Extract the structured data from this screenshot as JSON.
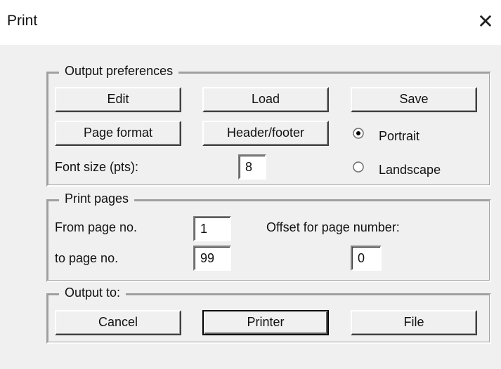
{
  "window": {
    "title": "Print"
  },
  "output_preferences": {
    "legend": "Output preferences",
    "edit_label": "Edit",
    "load_label": "Load",
    "save_label": "Save",
    "page_format_label": "Page format",
    "header_footer_label": "Header/footer",
    "font_size_label": "Font size (pts):",
    "font_size_value": "8",
    "orientation": {
      "selected": "Portrait",
      "portrait_label": "Portrait",
      "landscape_label": "Landscape"
    }
  },
  "print_pages": {
    "legend": "Print pages",
    "from_label": "From page no.",
    "from_value": "1",
    "to_label": "to page no.",
    "to_value": "99",
    "offset_label": "Offset for page number:",
    "offset_value": "0"
  },
  "output_to": {
    "legend": "Output to:",
    "cancel_label": "Cancel",
    "printer_label": "Printer",
    "file_label": "File",
    "default_button": "Printer"
  },
  "icons": {
    "close": "close-icon",
    "radio_selected": "radio-selected-icon",
    "radio_empty": "radio-empty-icon"
  }
}
